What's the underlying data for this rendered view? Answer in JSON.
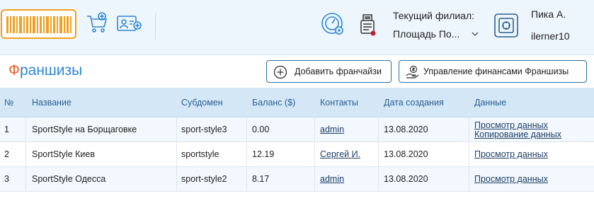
{
  "header": {
    "branch_label": "Текущий филиал:",
    "branch_value": "Площадь По...",
    "user_name": "Пика А.",
    "user_login": "ilerner10",
    "icons": [
      "barcode-icon",
      "cart-add-icon",
      "client-card-add-icon",
      "dashboard-gauge-icon",
      "receipt-printer-icon",
      "safe-icon",
      "chevron-down-icon"
    ]
  },
  "page": {
    "title_first": "Ф",
    "title_rest": "раншизы",
    "add_button": "Добавить франчайзи",
    "finance_button": "Управление финансами Франшизы"
  },
  "table": {
    "headers": {
      "num": "№",
      "name": "Название",
      "subdomain": "Субдомен",
      "balance": "Баланс ($)",
      "contacts": "Контакты",
      "created": "Дата создания",
      "data": "Данные"
    },
    "rows": [
      {
        "num": "1",
        "name": "SportStyle на Борщаговке",
        "subdomain": "sport-style3",
        "balance": "0.00",
        "contact": "admin",
        "created": "13.08.2020",
        "data_links": [
          "Просмотр данных",
          "Копирование данных"
        ]
      },
      {
        "num": "2",
        "name": "SportStyle Киев",
        "subdomain": "sportstyle",
        "balance": "12.19",
        "contact": "Сергей И.",
        "created": "13.08.2020",
        "data_links": [
          "Просмотр данных"
        ]
      },
      {
        "num": "3",
        "name": "SportStyle Одесса",
        "subdomain": "sport-style2",
        "balance": "8.17",
        "contact": "admin",
        "created": "13.08.2020",
        "data_links": [
          "Просмотр данных"
        ]
      }
    ]
  },
  "colors": {
    "accent_orange": "#f0a020",
    "title_blue": "#2e86d6",
    "title_orange": "#e8642b",
    "header_bg": "#eef6fd",
    "table_header_bg": "#d3e7f7"
  }
}
